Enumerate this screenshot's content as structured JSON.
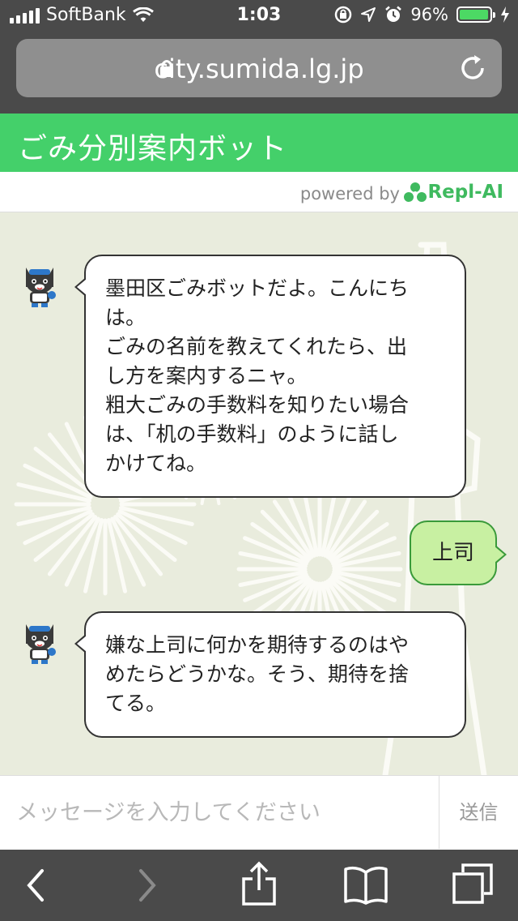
{
  "status_bar": {
    "carrier": "SoftBank",
    "time": "1:03",
    "battery_percent": "96%",
    "battery_level": 0.96,
    "icons": [
      "signal-icon",
      "wifi-icon",
      "orientation-lock-icon",
      "location-icon",
      "alarm-icon",
      "battery-icon",
      "charging-icon"
    ]
  },
  "browser": {
    "url": "city.sumida.lg.jp"
  },
  "app": {
    "title": "ごみ分別案内ボット",
    "powered_by": "powered by",
    "brand": "Repl-AI"
  },
  "messages": [
    {
      "sender": "bot",
      "lines": [
        "墨田区ごみボットだよ。こんにち",
        "は。",
        "ごみの名前を教えてくれたら、出",
        "し方を案内するニャ。",
        "粗大ごみの手数料を知りたい場合",
        "は、「机の手数料」のように話し",
        "かけてね。"
      ]
    },
    {
      "sender": "user",
      "text": "上司"
    },
    {
      "sender": "bot",
      "lines": [
        "嫌な上司に何かを期待するのはや",
        "めたらどうかな。そう、期待を捨",
        "てる。"
      ]
    }
  ],
  "input": {
    "placeholder": "メッセージを入力してください",
    "value": "",
    "send_label": "送信"
  },
  "colors": {
    "header": "#44d06a",
    "chat_bg": "#e9ecdd",
    "user_bubble": "#c8f0a2",
    "brand": "#3fba5f",
    "battery": "#4cd964"
  }
}
